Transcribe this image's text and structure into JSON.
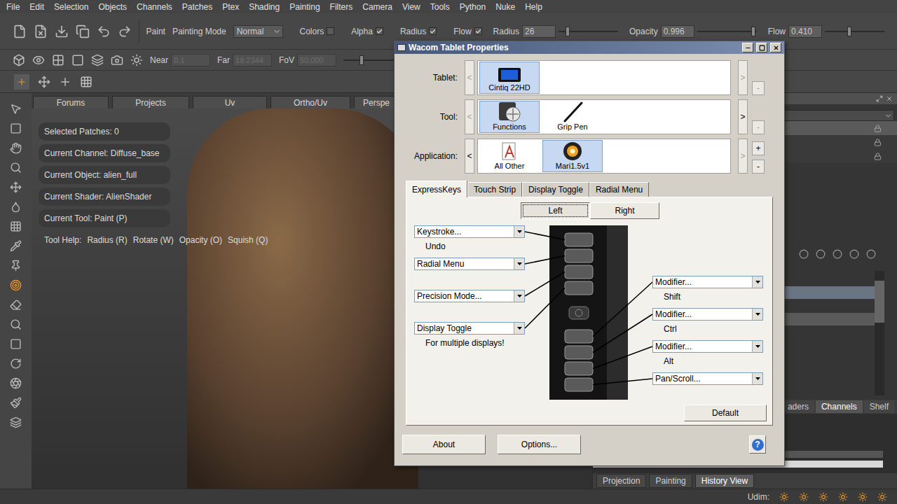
{
  "menu": [
    "File",
    "Edit",
    "Selection",
    "Objects",
    "Channels",
    "Patches",
    "Ptex",
    "Shading",
    "Painting",
    "Filters",
    "Camera",
    "View",
    "Tools",
    "Python",
    "Nuke",
    "Help"
  ],
  "toolbar": {
    "paint": "Paint",
    "painting_mode": {
      "label": "Painting Mode",
      "value": "Normal"
    },
    "toggles": [
      {
        "label": "Colors",
        "checked": false
      },
      {
        "label": "Alpha",
        "checked": true
      },
      {
        "label": "Radius",
        "checked": true
      },
      {
        "label": "Flow",
        "checked": true
      }
    ],
    "sliders": [
      {
        "label": "Radius",
        "value": "26",
        "level": 0.15
      },
      {
        "label": "Opacity",
        "value": "0.996",
        "level": 0.95
      },
      {
        "label": "Flow",
        "value": "0.410",
        "level": 0.41
      }
    ]
  },
  "camera": {
    "fields": [
      {
        "label": "Near",
        "value": "0.1"
      },
      {
        "label": "Far",
        "value": "19.2344"
      },
      {
        "label": "FoV",
        "value": "50.000"
      }
    ],
    "level": 0.3
  },
  "view_tabs": [
    {
      "label": "Forums",
      "selected": false
    },
    {
      "label": "Projects",
      "selected": false
    },
    {
      "label": "Uv",
      "selected": false
    },
    {
      "label": "Ortho/Uv",
      "selected": false
    },
    {
      "label": "Perspe",
      "selected": false
    }
  ],
  "info": [
    "Selected Patches: 0",
    "Current Channel: Diffuse_base",
    "Current Object: alien_full",
    "Current Shader: AlienShader",
    "Current Tool: Paint (P)"
  ],
  "tool_help": {
    "label": "Tool Help:",
    "items": [
      "Radius (R)",
      "Rotate (W)",
      "Opacity (O)",
      "Squish (Q)"
    ]
  },
  "right_tabs": [
    {
      "label": "aders",
      "selected": false
    },
    {
      "label": "Channels",
      "selected": true
    },
    {
      "label": "Shelf",
      "selected": false
    }
  ],
  "bottom_tabs": [
    {
      "label": "Projection",
      "selected": false
    },
    {
      "label": "Painting",
      "selected": false
    },
    {
      "label": "History View",
      "selected": true
    }
  ],
  "status_bar": {
    "udim_label": "Udim:"
  },
  "dialog": {
    "title": "Wacom Tablet Properties",
    "rows": [
      {
        "label": "Tablet:",
        "prev": {
          "glyph": "<",
          "disabled": true
        },
        "next": {
          "glyph": ">",
          "disabled": true
        },
        "items": [
          {
            "name": "Cintiq 22HD",
            "kind": "tablet",
            "selected": true
          }
        ],
        "buttons": [
          {
            "glyph": "-",
            "disabled": true
          }
        ]
      },
      {
        "label": "Tool:",
        "prev": {
          "glyph": "<",
          "disabled": true
        },
        "next": {
          "glyph": ">",
          "disabled": false
        },
        "items": [
          {
            "name": "Functions",
            "kind": "functions",
            "selected": true
          },
          {
            "name": "Grip Pen",
            "kind": "pen",
            "selected": false
          }
        ],
        "buttons": [
          {
            "glyph": "-",
            "disabled": true
          }
        ]
      },
      {
        "label": "Application:",
        "prev": {
          "glyph": "<",
          "disabled": false
        },
        "next": {
          "glyph": ">",
          "disabled": true
        },
        "items": [
          {
            "name": "All Other",
            "kind": "all-other",
            "selected": false
          },
          {
            "name": "Mari1.5v1",
            "kind": "mari",
            "selected": true
          }
        ],
        "buttons": [
          {
            "glyph": "+",
            "disabled": false
          },
          {
            "glyph": "-",
            "disabled": false
          }
        ]
      }
    ],
    "tabs": [
      {
        "label": "ExpressKeys",
        "selected": true
      },
      {
        "label": "Touch Strip",
        "selected": false
      },
      {
        "label": "Display Toggle",
        "selected": false
      },
      {
        "label": "Radial Menu",
        "selected": false
      }
    ],
    "sides": [
      {
        "label": "Left",
        "selected": true
      },
      {
        "label": "Right",
        "selected": false
      }
    ],
    "left_keys": [
      {
        "action": "Keystroke...",
        "note": "Undo"
      },
      {
        "action": "Radial Menu"
      },
      {
        "action": "Precision Mode..."
      },
      {
        "action": "Display Toggle",
        "note": "For multiple displays!"
      }
    ],
    "right_keys": [
      {
        "action": "Modifier...",
        "note": "Shift"
      },
      {
        "action": "Modifier...",
        "note": "Ctrl"
      },
      {
        "action": "Modifier...",
        "note": "Alt"
      },
      {
        "action": "Pan/Scroll..."
      }
    ],
    "default_button": "Default",
    "footer_buttons": [
      "About",
      "Options..."
    ],
    "help": "?"
  }
}
